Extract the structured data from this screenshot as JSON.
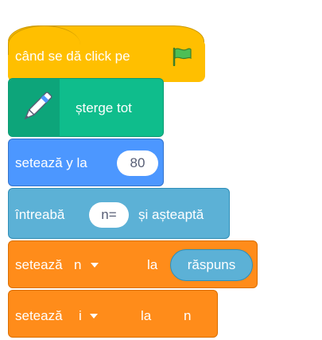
{
  "blocks": {
    "when_flag": {
      "label": "când se dă click pe",
      "icon": "green-flag-icon",
      "color": "#ffbf00"
    },
    "erase_all": {
      "label": "șterge tot",
      "icon": "pen-icon",
      "color": "#0fbd8c"
    },
    "set_y": {
      "label": "setează y la",
      "value": "80",
      "color": "#4c97ff"
    },
    "ask": {
      "label_before": "întreabă",
      "value": "n=",
      "label_after": "și așteaptă",
      "color": "#5cb1d6"
    },
    "set_n": {
      "label_before": "setează",
      "variable": "n",
      "label_mid": "la",
      "reporter": "răspuns",
      "color": "#ff8c1a"
    },
    "set_i": {
      "label_before": "setează",
      "variable": "i",
      "label_mid": "la",
      "value": "n",
      "color": "#ff8c1a"
    }
  }
}
